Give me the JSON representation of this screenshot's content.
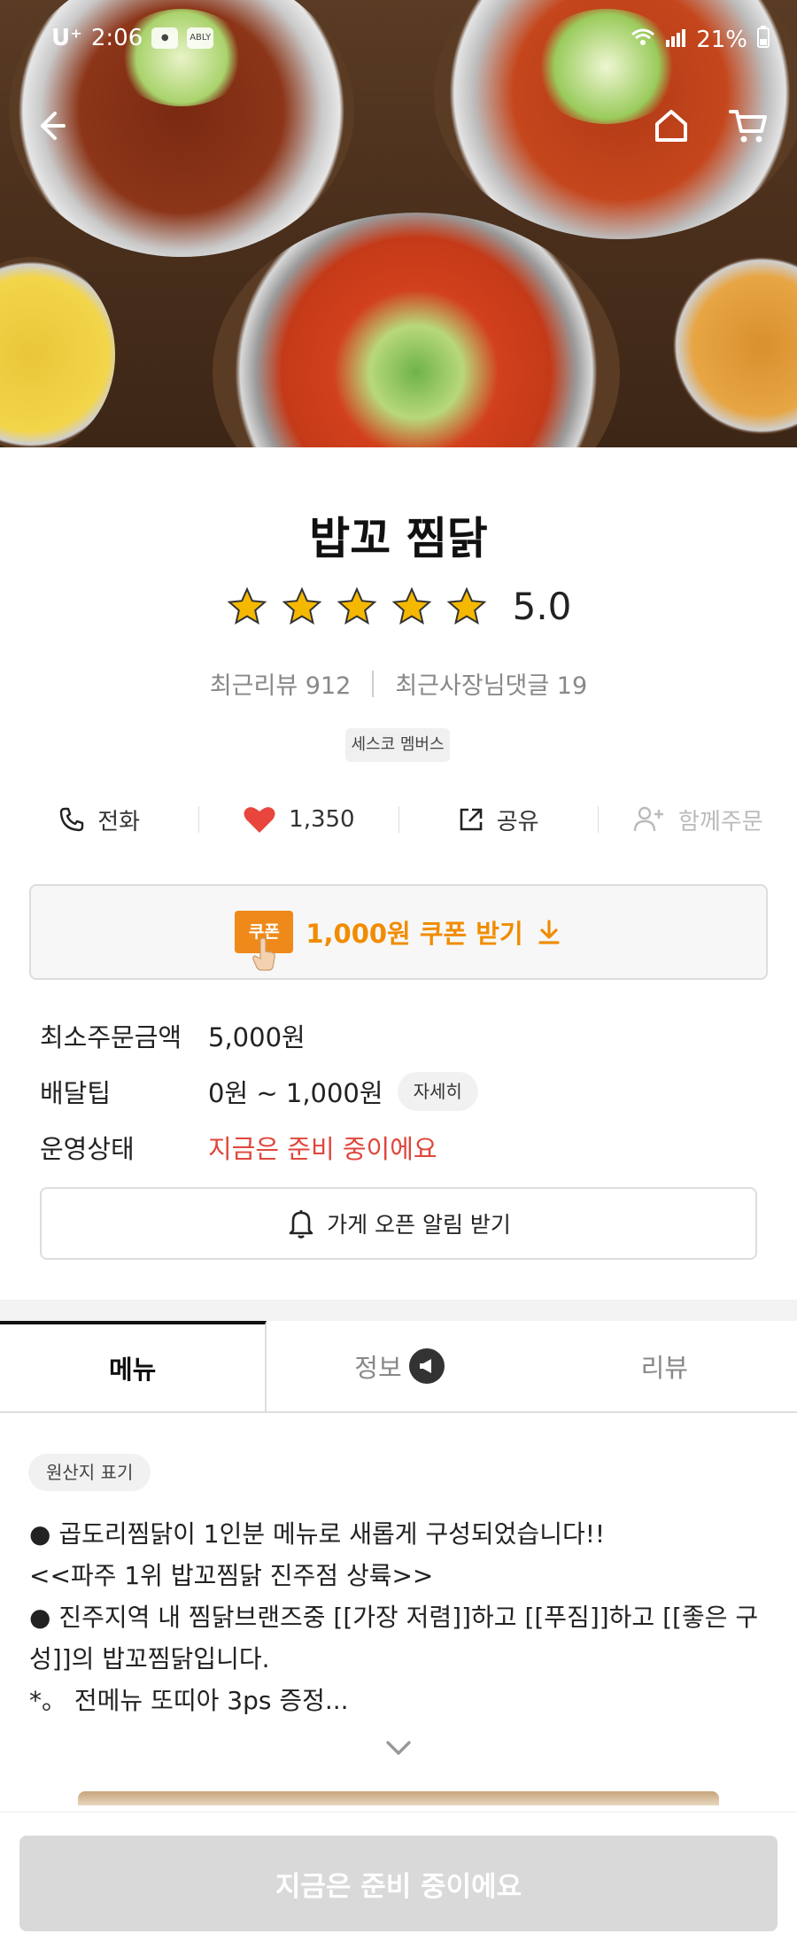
{
  "status_bar": {
    "carrier": "U⁺",
    "time": "2:06",
    "chips": [
      "ABLY"
    ],
    "battery": "21%"
  },
  "store": {
    "name": "밥꼬 찜닭",
    "rating": "5.0",
    "stars": 5,
    "recent_reviews_label": "최근리뷰 912",
    "owner_replies_label": "최근사장님댓글 19",
    "badge": "세스코 멤버스"
  },
  "actions": {
    "call": "전화",
    "likes": "1,350",
    "share": "공유",
    "group_order": "함께주문"
  },
  "coupon": {
    "tag": "쿠폰",
    "label": "1,000원 쿠폰 받기"
  },
  "info": {
    "min_order_label": "최소주문금액",
    "min_order_value": "5,000원",
    "delivery_tip_label": "배달팁",
    "delivery_tip_value": "0원 ~ 1,000원",
    "detail_button": "자세히",
    "status_label": "운영상태",
    "status_value": "지금은 준비 중이에요"
  },
  "alarm_button": "가게 오픈 알림 받기",
  "tabs": [
    "메뉴",
    "정보",
    "리뷰"
  ],
  "origin_chip": "원산지 표기",
  "description": [
    "● 곱도리찜닭이 1인분 메뉴로 새롭게 구성되었습니다!!",
    "<<파주 1위 밥꼬찜닭 진주점 상륙>>",
    "● 진주지역 내 찜닭브랜즈중 [[가장 저렴]]하고 [[푸짐]]하고 [[좋은 구성]]의 밥꼬찜닭입니다.",
    "*。 전메뉴 또띠아 3ps 증정..."
  ],
  "bottom_button": "지금은 준비 중이에요",
  "colors": {
    "accent_orange": "#f08c00",
    "status_red": "#e0463b",
    "heart_red": "#e8453c",
    "star_yellow": "#f5b800"
  }
}
